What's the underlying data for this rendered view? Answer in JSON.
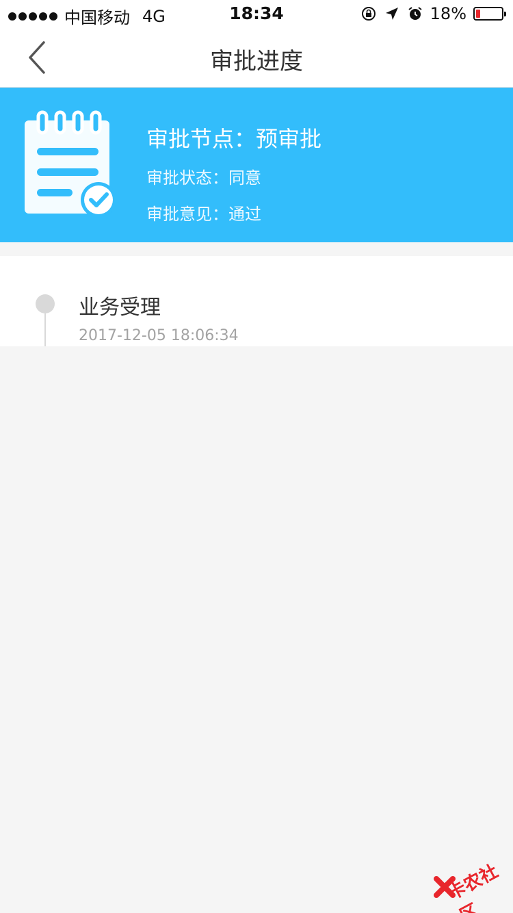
{
  "status_bar": {
    "carrier": "中国移动",
    "network": "4G",
    "time": "18:34",
    "battery_percent": "18%",
    "battery_level": 0.18
  },
  "nav": {
    "title": "审批进度",
    "back_icon": "chevron-left-icon"
  },
  "approval": {
    "node_label": "审批节点：",
    "node_value": "预审批",
    "status_label": "审批状态：",
    "status_value": "同意",
    "opinion_label": "审批意见：",
    "opinion_value": "通过",
    "icon": "clipboard-check-icon",
    "accent_color": "#33bdfb"
  },
  "timeline": {
    "items": [
      {
        "title": "业务受理",
        "time": "2017-12-05 18:06:34"
      }
    ]
  },
  "watermark": {
    "text": "卡农社区",
    "color": "#e8262c"
  }
}
